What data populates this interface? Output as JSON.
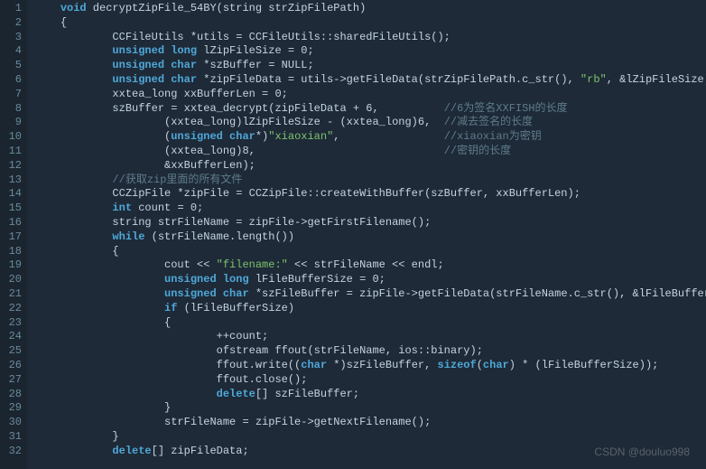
{
  "watermark": "CSDN @douluo998",
  "colors": {
    "bg": "#1e2a38",
    "gutter_bg": "#1a2530",
    "gutter_fg": "#6b8a9c",
    "divider": "#3a5265",
    "text": "#c5d4de",
    "keyword": "#4fa8d8",
    "string": "#7ec46b",
    "comment": "#5f7c8a"
  },
  "lines": [
    {
      "n": "1",
      "indent": "    ",
      "tokens": [
        {
          "t": "kw",
          "v": "void"
        },
        {
          "t": "",
          "v": " decryptZipFile_54BY(string strZipFilePath)"
        }
      ]
    },
    {
      "n": "2",
      "indent": "    ",
      "tokens": [
        {
          "t": "",
          "v": "{"
        }
      ]
    },
    {
      "n": "3",
      "indent": "            ",
      "tokens": [
        {
          "t": "",
          "v": "CCFileUtils *utils = CCFileUtils::sharedFileUtils();"
        }
      ]
    },
    {
      "n": "4",
      "indent": "            ",
      "tokens": [
        {
          "t": "kw",
          "v": "unsigned"
        },
        {
          "t": "",
          "v": " "
        },
        {
          "t": "kw",
          "v": "long"
        },
        {
          "t": "",
          "v": " lZipFileSize = 0;"
        }
      ]
    },
    {
      "n": "5",
      "indent": "            ",
      "tokens": [
        {
          "t": "kw",
          "v": "unsigned"
        },
        {
          "t": "",
          "v": " "
        },
        {
          "t": "kw",
          "v": "char"
        },
        {
          "t": "",
          "v": " *szBuffer = NULL;"
        }
      ]
    },
    {
      "n": "6",
      "indent": "            ",
      "tokens": [
        {
          "t": "kw",
          "v": "unsigned"
        },
        {
          "t": "",
          "v": " "
        },
        {
          "t": "kw",
          "v": "char"
        },
        {
          "t": "",
          "v": " *zipFileData = utils->getFileData(strZipFilePath.c_str(), "
        },
        {
          "t": "str",
          "v": "\"rb\""
        },
        {
          "t": "",
          "v": ", &lZipFileSize);"
        }
      ]
    },
    {
      "n": "7",
      "indent": "            ",
      "tokens": [
        {
          "t": "",
          "v": "xxtea_long xxBufferLen = 0;"
        }
      ]
    },
    {
      "n": "8",
      "indent": "            ",
      "tokens": [
        {
          "t": "",
          "v": "szBuffer = xxtea_decrypt(zipFileData + 6,          "
        },
        {
          "t": "cmt",
          "v": "//6为签名XXFISH的长度"
        }
      ]
    },
    {
      "n": "9",
      "indent": "                    ",
      "tokens": [
        {
          "t": "",
          "v": "(xxtea_long)lZipFileSize - (xxtea_long)6,  "
        },
        {
          "t": "cmt",
          "v": "//减去签名的长度"
        }
      ]
    },
    {
      "n": "10",
      "indent": "                    ",
      "tokens": [
        {
          "t": "",
          "v": "("
        },
        {
          "t": "kw",
          "v": "unsigned"
        },
        {
          "t": "",
          "v": " "
        },
        {
          "t": "kw",
          "v": "char"
        },
        {
          "t": "",
          "v": "*)"
        },
        {
          "t": "str",
          "v": "\"xiaoxian\""
        },
        {
          "t": "",
          "v": ",                "
        },
        {
          "t": "cmt",
          "v": "//xiaoxian为密钥"
        }
      ]
    },
    {
      "n": "11",
      "indent": "                    ",
      "tokens": [
        {
          "t": "",
          "v": "(xxtea_long)8,                             "
        },
        {
          "t": "cmt",
          "v": "//密钥的长度"
        }
      ]
    },
    {
      "n": "12",
      "indent": "                    ",
      "tokens": [
        {
          "t": "",
          "v": "&xxBufferLen);"
        }
      ]
    },
    {
      "n": "13",
      "indent": "            ",
      "tokens": [
        {
          "t": "cmt",
          "v": "//获取zip里面的所有文件"
        }
      ]
    },
    {
      "n": "14",
      "indent": "            ",
      "tokens": [
        {
          "t": "",
          "v": "CCZipFile *zipFile = CCZipFile::createWithBuffer(szBuffer, xxBufferLen);"
        }
      ]
    },
    {
      "n": "15",
      "indent": "            ",
      "tokens": [
        {
          "t": "kw",
          "v": "int"
        },
        {
          "t": "",
          "v": " count = 0;"
        }
      ]
    },
    {
      "n": "16",
      "indent": "            ",
      "tokens": [
        {
          "t": "",
          "v": "string strFileName = zipFile->getFirstFilename();"
        }
      ]
    },
    {
      "n": "17",
      "indent": "            ",
      "tokens": [
        {
          "t": "kw",
          "v": "while"
        },
        {
          "t": "",
          "v": " (strFileName.length())"
        }
      ]
    },
    {
      "n": "18",
      "indent": "            ",
      "tokens": [
        {
          "t": "",
          "v": "{"
        }
      ]
    },
    {
      "n": "19",
      "indent": "                    ",
      "tokens": [
        {
          "t": "",
          "v": "cout << "
        },
        {
          "t": "str",
          "v": "\"filename:\""
        },
        {
          "t": "",
          "v": " << strFileName << endl;"
        }
      ]
    },
    {
      "n": "20",
      "indent": "                    ",
      "tokens": [
        {
          "t": "kw",
          "v": "unsigned"
        },
        {
          "t": "",
          "v": " "
        },
        {
          "t": "kw",
          "v": "long"
        },
        {
          "t": "",
          "v": " lFileBufferSize = 0;"
        }
      ]
    },
    {
      "n": "21",
      "indent": "                    ",
      "tokens": [
        {
          "t": "kw",
          "v": "unsigned"
        },
        {
          "t": "",
          "v": " "
        },
        {
          "t": "kw",
          "v": "char"
        },
        {
          "t": "",
          "v": " *szFileBuffer = zipFile->getFileData(strFileName.c_str(), &lFileBufferSize);"
        }
      ]
    },
    {
      "n": "22",
      "indent": "                    ",
      "tokens": [
        {
          "t": "kw",
          "v": "if"
        },
        {
          "t": "",
          "v": " (lFileBufferSize)"
        }
      ]
    },
    {
      "n": "23",
      "indent": "                    ",
      "tokens": [
        {
          "t": "",
          "v": "{"
        }
      ]
    },
    {
      "n": "24",
      "indent": "                            ",
      "tokens": [
        {
          "t": "",
          "v": "++count;"
        }
      ]
    },
    {
      "n": "25",
      "indent": "                            ",
      "tokens": [
        {
          "t": "",
          "v": "ofstream ffout(strFileName, ios::binary);"
        }
      ]
    },
    {
      "n": "26",
      "indent": "                            ",
      "tokens": [
        {
          "t": "",
          "v": "ffout.write(("
        },
        {
          "t": "kw",
          "v": "char"
        },
        {
          "t": "",
          "v": " *)szFileBuffer, "
        },
        {
          "t": "kw",
          "v": "sizeof"
        },
        {
          "t": "",
          "v": "("
        },
        {
          "t": "kw",
          "v": "char"
        },
        {
          "t": "",
          "v": ") * (lFileBufferSize));"
        }
      ]
    },
    {
      "n": "27",
      "indent": "                            ",
      "tokens": [
        {
          "t": "",
          "v": "ffout.close();"
        }
      ]
    },
    {
      "n": "28",
      "indent": "                            ",
      "tokens": [
        {
          "t": "kw",
          "v": "delete"
        },
        {
          "t": "",
          "v": "[] szFileBuffer;"
        }
      ]
    },
    {
      "n": "29",
      "indent": "                    ",
      "tokens": [
        {
          "t": "",
          "v": "}"
        }
      ]
    },
    {
      "n": "30",
      "indent": "                    ",
      "tokens": [
        {
          "t": "",
          "v": "strFileName = zipFile->getNextFilename();"
        }
      ]
    },
    {
      "n": "31",
      "indent": "            ",
      "tokens": [
        {
          "t": "",
          "v": "}"
        }
      ]
    },
    {
      "n": "32",
      "indent": "            ",
      "tokens": [
        {
          "t": "kw",
          "v": "delete"
        },
        {
          "t": "",
          "v": "[] zipFileData;"
        }
      ]
    }
  ]
}
